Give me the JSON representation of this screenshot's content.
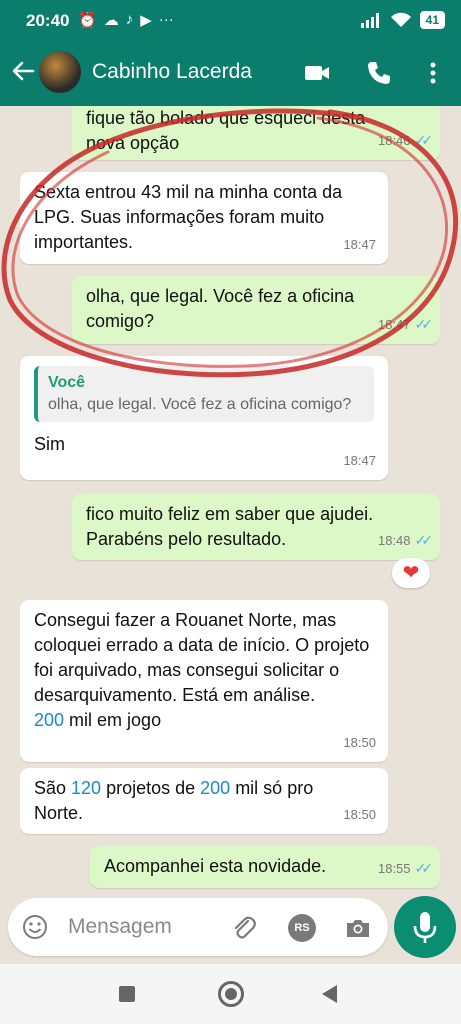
{
  "status": {
    "time": "20:40",
    "battery": "41"
  },
  "header": {
    "contact_name": "Cabinho Lacerda"
  },
  "messages": [
    {
      "dir": "out",
      "text": "fique tão bolado que esqueci desta nova opção",
      "time": "18:46"
    },
    {
      "dir": "in",
      "text": "Sexta entrou 43 mil na minha conta da LPG. Suas informações foram muito importantes.",
      "time": "18:47"
    },
    {
      "dir": "out",
      "text": "olha, que legal. Você fez a oficina comigo?",
      "time": "18:47"
    },
    {
      "dir": "in",
      "quote_author": "Você",
      "quote_text": "olha, que legal. Você fez a oficina comigo?",
      "text": "Sim",
      "time": "18:47"
    },
    {
      "dir": "out",
      "text": "fico muito feliz em saber que ajudei. Parabéns pelo resultado.",
      "time": "18:48",
      "reaction": "❤"
    },
    {
      "dir": "in",
      "text_main": "Consegui fazer a Rouanet Norte, mas coloquei errado a data de início. O projeto foi arquivado, mas consegui solicitar o desarquivamento. Está em análise.",
      "num1": "200",
      "text_tail": " mil em jogo",
      "time": "18:50"
    },
    {
      "dir": "in",
      "pre": "São ",
      "num1": "120",
      "mid": " projetos de ",
      "num2": "200",
      "post": " mil só pro Norte.",
      "time": "18:50"
    },
    {
      "dir": "out",
      "text": "Acompanhei esta novidade.",
      "time": "18:55"
    }
  ],
  "composer": {
    "placeholder": "Mensagem",
    "rs_label": "RS"
  },
  "colors": {
    "header": "#0a7d6c",
    "outgoing": "#dcf8c6",
    "incoming": "#ffffff",
    "annotation": "#c62828",
    "ticks": "#4fb6ec"
  }
}
